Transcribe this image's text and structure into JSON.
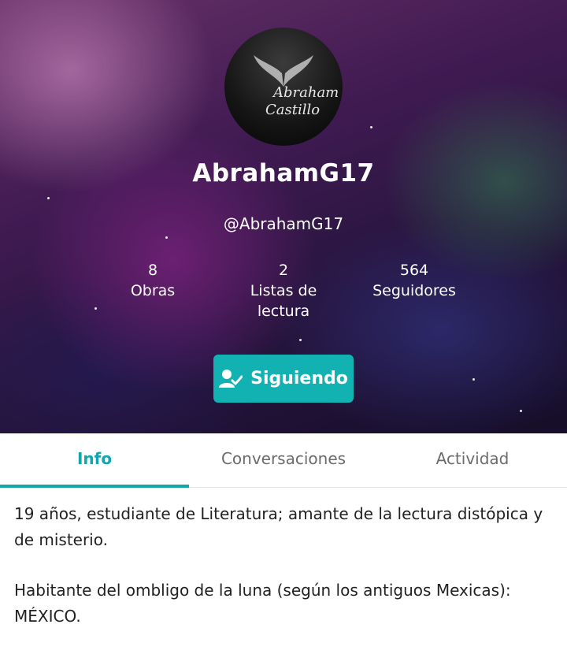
{
  "profile": {
    "display_name": "AbrahamG17",
    "handle": "@AbrahamG17",
    "avatar_text_line1": "Abraham",
    "avatar_text_line2": "Castillo"
  },
  "stats": [
    {
      "value": "8",
      "label": "Obras"
    },
    {
      "value": "2",
      "label": "Listas de lectura"
    },
    {
      "value": "564",
      "label": "Seguidores"
    }
  ],
  "follow_button": {
    "label": "Siguiendo",
    "icon": "user-check-icon"
  },
  "tabs": [
    {
      "label": "Info",
      "active": true
    },
    {
      "label": "Conversaciones",
      "active": false
    },
    {
      "label": "Actividad",
      "active": false
    }
  ],
  "bio": {
    "paragraph1": "19 años, estudiante de Literatura; amante de la lectura distópica y de misterio.",
    "paragraph2": "Habitante del ombligo de la luna (según los antiguos Mexicas): MÉXICO."
  },
  "colors": {
    "accent": "#12b2b2",
    "tab_active": "#12a6ac"
  }
}
